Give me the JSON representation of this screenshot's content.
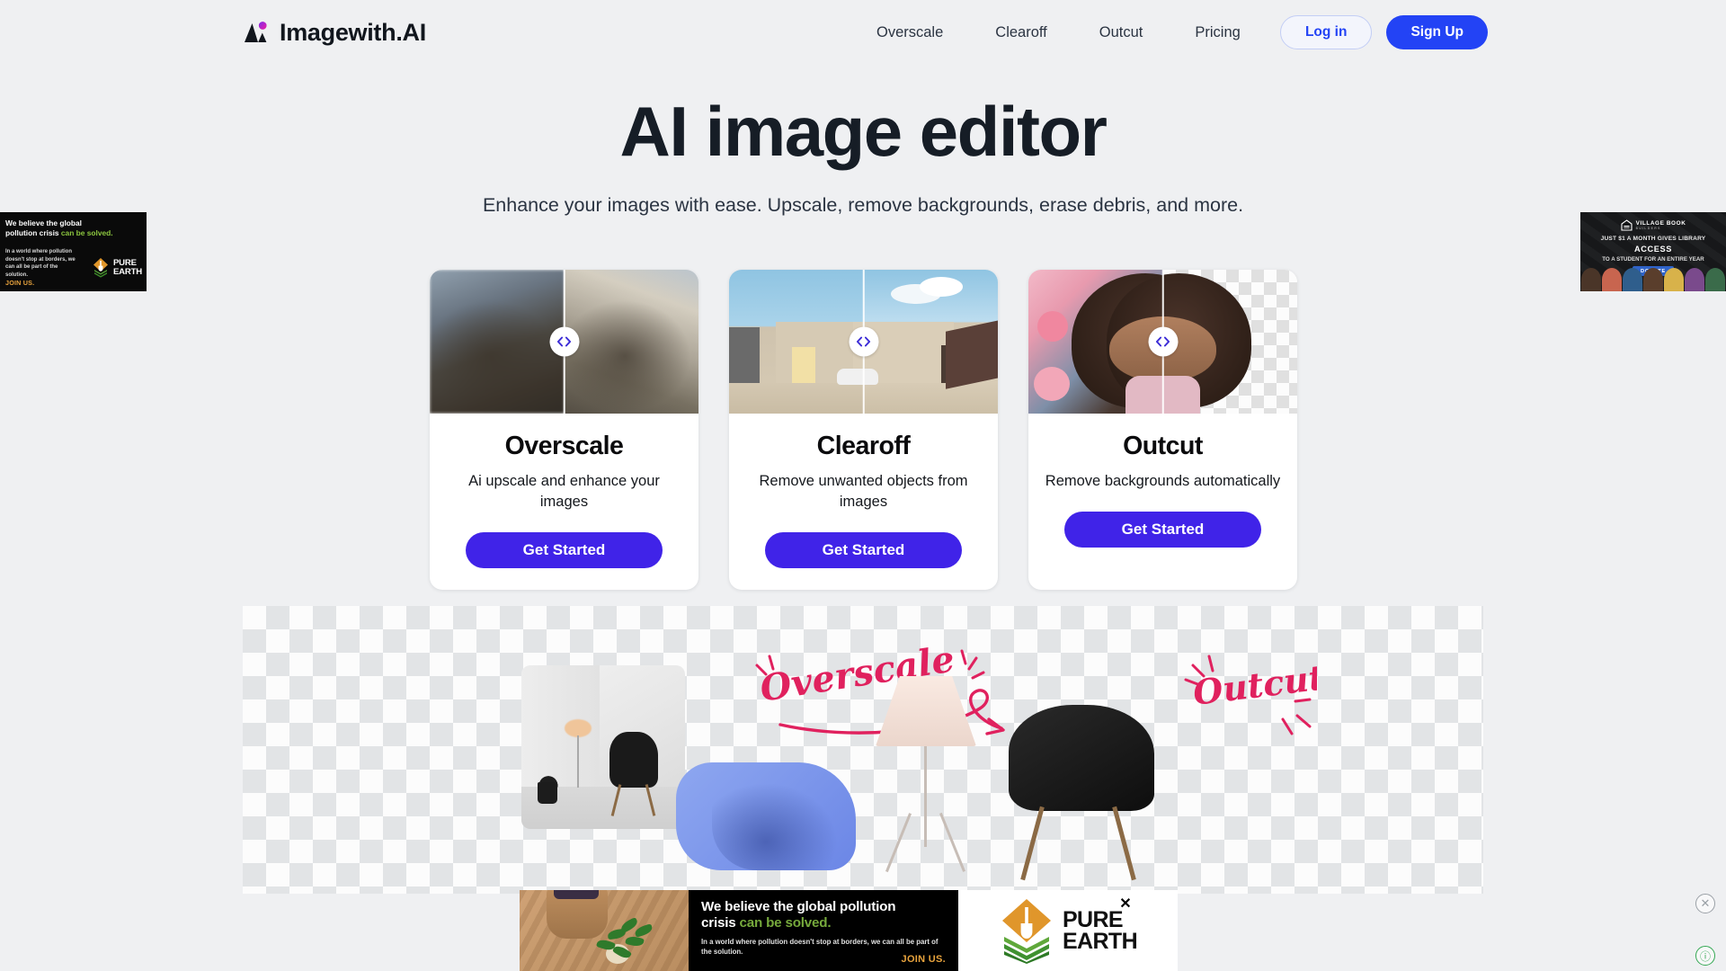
{
  "header": {
    "brand": {
      "name": "Imagewith.AI",
      "mark": "mountain-logo-icon"
    },
    "nav": [
      {
        "label": "Overscale"
      },
      {
        "label": "Clearoff"
      },
      {
        "label": "Outcut"
      },
      {
        "label": "Pricing"
      }
    ],
    "login_label": "Log in",
    "signup_label": "Sign Up",
    "colors": {
      "accent_blue": "#2343F5",
      "login_border": "#C3CEF5"
    }
  },
  "hero": {
    "title": "AI image editor",
    "subtitle": "Enhance your images with ease. Upscale, remove backgrounds, erase debris, and more."
  },
  "cards": [
    {
      "title": "Overscale",
      "description": "Ai upscale and enhance your images",
      "cta": "Get Started",
      "media": "before-after-lion-image",
      "handle": "compare-slider-handle"
    },
    {
      "title": "Clearoff",
      "description": "Remove unwanted objects from images",
      "cta": "Get Started",
      "media": "before-after-building-image",
      "handle": "compare-slider-handle"
    },
    {
      "title": "Outcut",
      "description": "Remove backgrounds automatically",
      "cta": "Get Started",
      "media": "before-after-portrait-image",
      "handle": "compare-slider-handle"
    }
  ],
  "card_cta_color": "#4023E8",
  "showcase": {
    "label_overscale": "Overscale",
    "label_outcut": "Outcut",
    "script_color": "#E0215E",
    "items": [
      "room-photo",
      "floor-lamp",
      "black-chair",
      "blue-plant-blob"
    ]
  },
  "ads": {
    "left": {
      "headline_a": "We believe the global",
      "headline_b": "pollution crisis ",
      "headline_green": "can be solved.",
      "body": "In a world where pollution doesn't stop at borders, we can all be part of the solution.",
      "join": "JOIN US.",
      "logo_line1": "PURE",
      "logo_line2": "EARTH"
    },
    "right": {
      "brand": "VILLAGE BOOK",
      "brand_sub": "BUILDERS",
      "line1": "JUST $1 A MONTH GIVES LIBRARY",
      "line2": "ACCESS",
      "line3": "TO A STUDENT FOR AN ENTIRE YEAR",
      "donate": "DONATE"
    },
    "bottom": {
      "headline_a": "We believe the global pollution",
      "headline_b": "crisis ",
      "headline_green": "can be solved.",
      "body": "In a world where pollution doesn't stop at borders, we can all be part of the solution.",
      "join": "JOIN US.",
      "logo_line1": "PURE",
      "logo_line2": "EARTH",
      "close": "✕",
      "control_close": "✕",
      "control_info": "ⓘ"
    }
  }
}
